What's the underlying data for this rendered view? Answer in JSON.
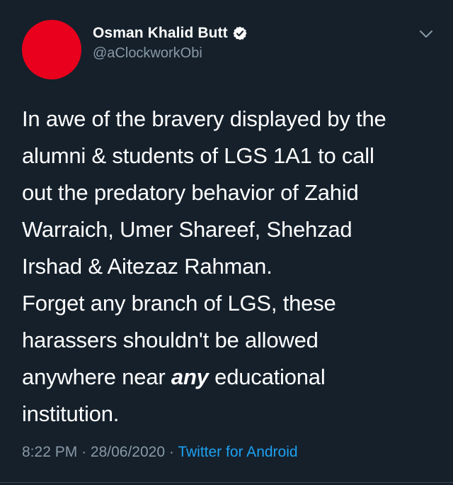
{
  "tweet": {
    "author": {
      "name": "Osman Khalid Butt",
      "handle": "@aClockworkObi",
      "avatar_color": "#e8001c",
      "verified": true
    },
    "text_lines": [
      "In awe of the bravery displayed by the",
      "alumni & students of LGS 1A1 to call",
      "out the predatory behavior of Zahid",
      "Warraich, Umer Shareef, Shehzad",
      "Irshad & Aitezaz Rahman.",
      "Forget any branch of LGS, these",
      "harassers shouldn't be allowed",
      "anywhere near",
      "institution."
    ],
    "emphasis_word": "any",
    "line8_tail": "educational",
    "time": "8:22 PM",
    "separator": "·",
    "date": "28/06/2020",
    "source": "Twitter for Android"
  },
  "icons": {
    "verified": "verified-badge-icon",
    "menu": "chevron-down-icon"
  },
  "colors": {
    "background": "#15202b",
    "secondary_text": "#8899a6",
    "link": "#1da1f2"
  }
}
